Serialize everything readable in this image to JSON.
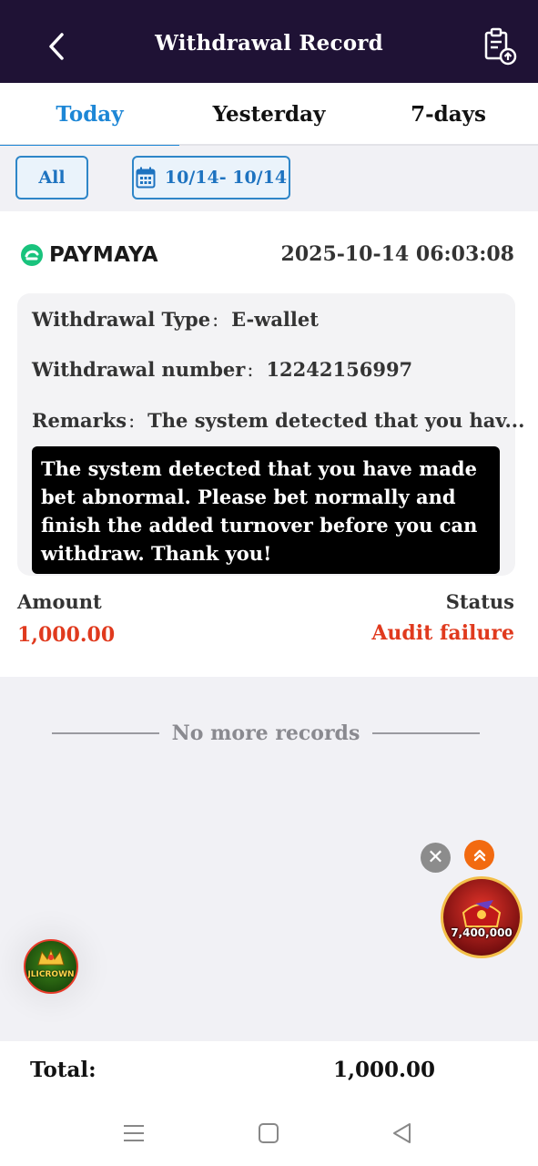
{
  "header": {
    "title": "Withdrawal Record",
    "back_icon": "chevron-left-icon",
    "action_icon": "clipboard-upload-icon"
  },
  "tabs": [
    {
      "label": "Today",
      "active": true
    },
    {
      "label": "Yesterday",
      "active": false
    },
    {
      "label": "7-days",
      "active": false
    }
  ],
  "filters": {
    "all_label": "All",
    "date_range": "10/14- 10/14",
    "date_icon": "calendar-icon"
  },
  "record": {
    "provider": "PAYMAYA",
    "provider_icon": "paymaya-logo-icon",
    "datetime": "2025-10-14 06:03:08",
    "type_label": "Withdrawal Type",
    "type_value": "E-wallet",
    "number_label": "Withdrawal number",
    "number_value": "12242156997",
    "remarks_label": "Remarks",
    "remarks_value": "The system detected that you hav...",
    "separator": ":",
    "remarks_full": "The system detected that you have made bet abnormal. Please bet normally and finish the added turnover before you can withdraw. Thank you!",
    "amount_label": "Amount",
    "amount_value": "1,000.00",
    "status_label": "Status",
    "status_value": "Audit failure"
  },
  "list": {
    "end_text": "No more records"
  },
  "floating": {
    "close_icon": "close-icon",
    "up_icon": "double-chevron-up-icon",
    "promo_amount": "7,400,000",
    "badge_label": "JLICROWN"
  },
  "footer": {
    "total_label": "Total:",
    "total_value": "1,000.00"
  },
  "colors": {
    "header_bg": "#1f1235",
    "accent": "#1e87d6",
    "error": "#e03a1e"
  }
}
